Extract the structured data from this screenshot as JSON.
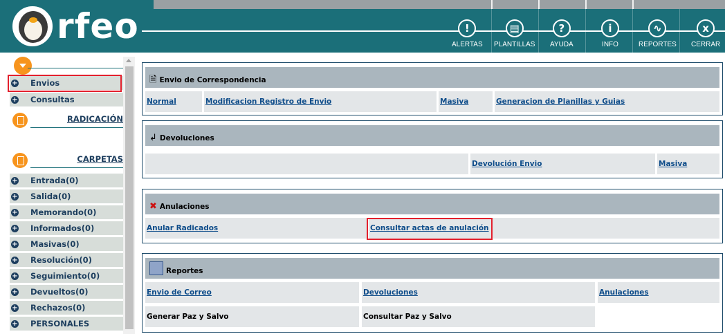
{
  "app": {
    "logo_text": "rfeo",
    "colors": {
      "header_bg": "#1b6f79",
      "accent_orange": "#f7941d",
      "panel_head": "#aab6be",
      "link": "#0f4d8a",
      "highlight": "#e3202d"
    }
  },
  "header": {
    "buttons": [
      {
        "label": "ALERTAS",
        "icon": "alert-icon",
        "glyph": "!"
      },
      {
        "label": "PLANTILLAS",
        "icon": "templates-icon",
        "glyph": "▤"
      },
      {
        "label": "AYUDA",
        "icon": "help-icon",
        "glyph": "?"
      },
      {
        "label": "INFO",
        "icon": "info-icon",
        "glyph": "i"
      },
      {
        "label": "REPORTES",
        "icon": "reports-icon",
        "glyph": "∿"
      },
      {
        "label": "CERRAR",
        "icon": "close-icon",
        "glyph": "x"
      }
    ]
  },
  "sidebar": {
    "top_items": [
      {
        "label": "Envios",
        "selected": true
      },
      {
        "label": "Consultas"
      }
    ],
    "radicacion_label": "RADICACIÓN",
    "carpetas_label": "CARPETAS",
    "folders": [
      {
        "label": "Entrada(0)"
      },
      {
        "label": "Salida(0)"
      },
      {
        "label": "Memorando(0)"
      },
      {
        "label": "Informados(0)"
      },
      {
        "label": "Masivas(0)"
      },
      {
        "label": "Resolución(0)"
      },
      {
        "label": "Seguimiento(0)"
      },
      {
        "label": "Devueltos(0)"
      },
      {
        "label": "Rechazos(0)"
      },
      {
        "label": "PERSONALES"
      }
    ]
  },
  "panels": {
    "envio": {
      "title": "Envio de Correspondencia",
      "links": [
        "Normal",
        "Modificacion Registro de Envio",
        "Masiva",
        "Generacion de Planillas y Guias"
      ]
    },
    "devoluciones": {
      "title": "Devoluciones",
      "links": [
        "Devolución Envio",
        "Masiva"
      ]
    },
    "anulaciones": {
      "title": "Anulaciones",
      "links": [
        "Anular Radicados",
        "Consultar actas de anulación"
      ],
      "highlighted_link": "Consultar actas de anulación"
    },
    "reportes": {
      "title": "Reportes",
      "links": [
        "Envio de Correo",
        "Devoluciones",
        "Anulaciones"
      ],
      "actions": [
        "Generar Paz y Salvo",
        "Consultar Paz y Salvo"
      ]
    }
  }
}
